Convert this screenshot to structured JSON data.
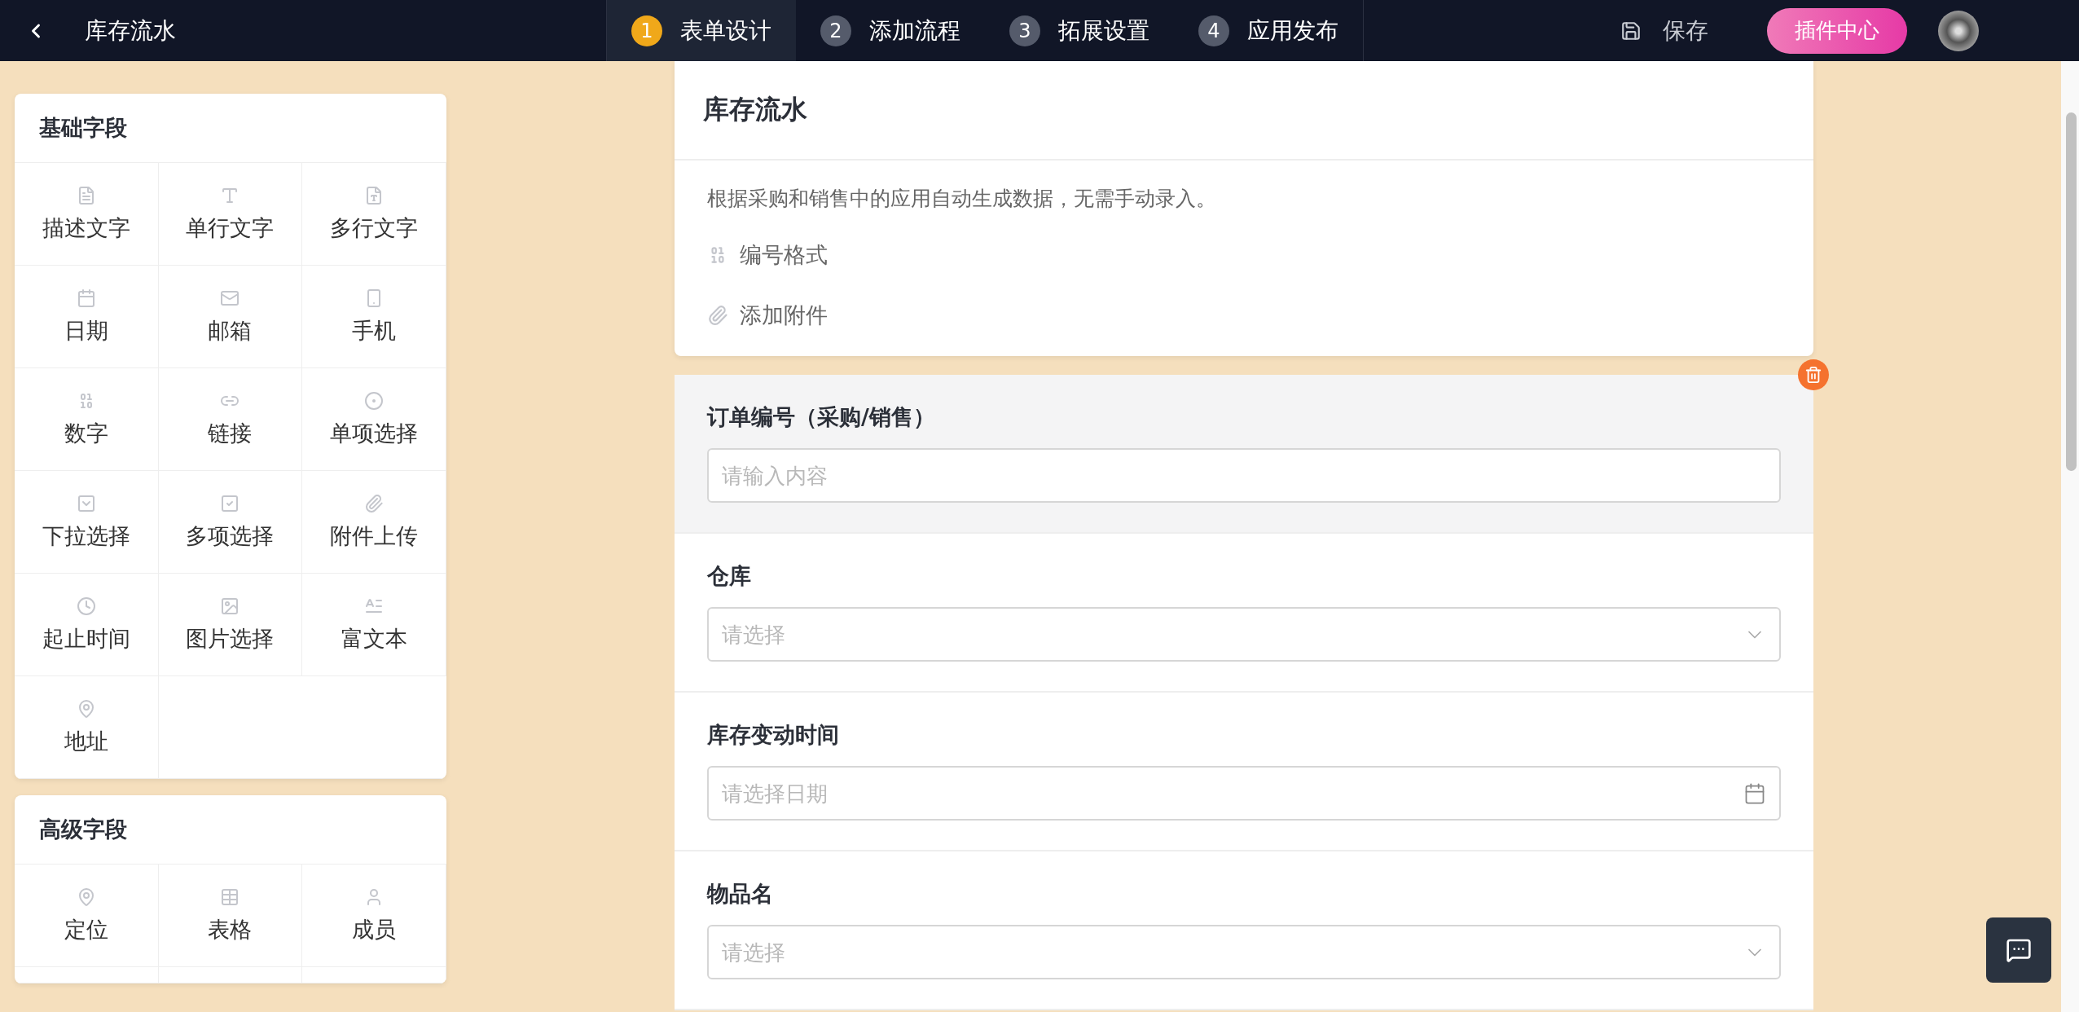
{
  "topbar": {
    "title": "库存流水",
    "steps": [
      {
        "number": "1",
        "label": "表单设计",
        "selected": true
      },
      {
        "number": "2",
        "label": "添加流程",
        "selected": false
      },
      {
        "number": "3",
        "label": "拓展设置",
        "selected": false
      },
      {
        "number": "4",
        "label": "应用发布",
        "selected": false
      }
    ],
    "save": "保存",
    "plugin_center": "插件中心"
  },
  "sidebar": {
    "groups": [
      {
        "title": "基础字段",
        "items": [
          "描述文字",
          "单行文字",
          "多行文字",
          "日期",
          "邮箱",
          "手机",
          "数字",
          "链接",
          "单项选择",
          "下拉选择",
          "多项选择",
          "附件上传",
          "起止时间",
          "图片选择",
          "富文本",
          "地址"
        ]
      },
      {
        "title": "高级字段",
        "items": [
          "定位",
          "表格",
          "成员"
        ]
      }
    ]
  },
  "form": {
    "title": "库存流水",
    "description": "根据采购和销售中的应用自动生成数据，无需手动录入。",
    "options": [
      "编号格式",
      "添加附件"
    ],
    "fields": [
      {
        "kind": "text",
        "label": "订单编号（采购/销售）",
        "placeholder": "请输入内容",
        "selected": true
      },
      {
        "kind": "select",
        "label": "仓库",
        "placeholder": "请选择",
        "selected": false
      },
      {
        "kind": "date",
        "label": "库存变动时间",
        "placeholder": "请选择日期",
        "selected": false
      },
      {
        "kind": "select",
        "label": "物品名",
        "placeholder": "请选择",
        "selected": false
      }
    ]
  }
}
